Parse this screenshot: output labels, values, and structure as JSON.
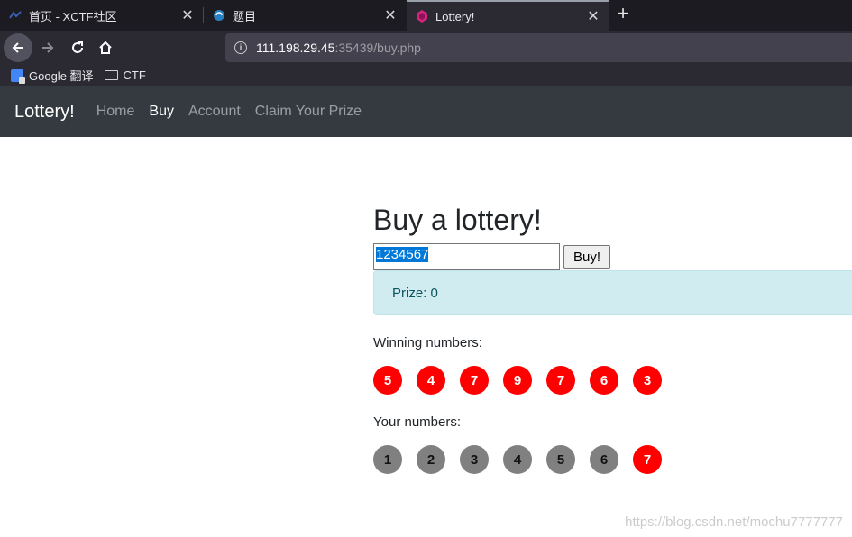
{
  "browser": {
    "tabs": [
      {
        "title": "首页 - XCTF社区",
        "active": false,
        "icon": "xctf-icon"
      },
      {
        "title": "题目",
        "active": false,
        "icon": "globe-icon"
      },
      {
        "title": "Lottery!",
        "active": true,
        "icon": "diamond-icon"
      }
    ],
    "url_host": "111.198.29.45",
    "url_rest": ":35439/buy.php",
    "bookmarks": [
      {
        "label": "Google 翻译",
        "icon": "google-translate-icon"
      },
      {
        "label": "CTF",
        "icon": "folder-icon"
      }
    ],
    "close_glyph": "✕",
    "new_tab_glyph": "+"
  },
  "site": {
    "brand": "Lottery!",
    "nav": [
      "Home",
      "Buy",
      "Account",
      "Claim Your Prize"
    ],
    "active_nav": "Buy"
  },
  "main": {
    "heading": "Buy a lottery!",
    "input_value": "1234567",
    "buy_label": "Buy!",
    "prize_text": "Prize: 0",
    "winning_label": "Winning numbers:",
    "your_label": "Your numbers:",
    "winning_numbers": [
      "5",
      "4",
      "7",
      "9",
      "7",
      "6",
      "3"
    ],
    "your_numbers": [
      "1",
      "2",
      "3",
      "4",
      "5",
      "6",
      "7"
    ],
    "matched_positions": [
      6
    ]
  },
  "watermark": "https://blog.csdn.net/mochu7777777",
  "colors": {
    "navbar": "#343a40",
    "alert_bg": "#d1ecf1",
    "ball_red": "#ff0000",
    "ball_gray": "#808080"
  }
}
